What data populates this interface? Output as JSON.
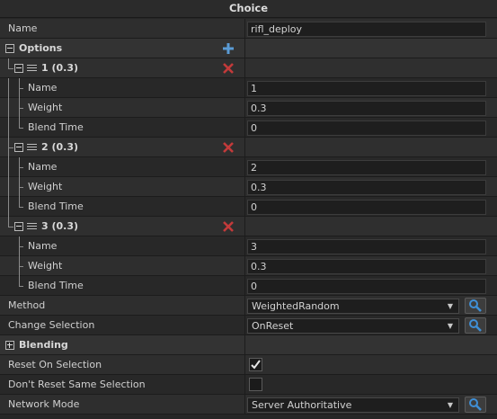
{
  "window_title": "Choice",
  "name": {
    "label": "Name",
    "value": "rifl_deploy"
  },
  "options": {
    "label": "Options",
    "items": [
      {
        "header": "1 (0.3)",
        "name_label": "Name",
        "name_value": "1",
        "weight_label": "Weight",
        "weight_value": "0.3",
        "blend_label": "Blend Time",
        "blend_value": "0"
      },
      {
        "header": "2 (0.3)",
        "name_label": "Name",
        "name_value": "2",
        "weight_label": "Weight",
        "weight_value": "0.3",
        "blend_label": "Blend Time",
        "blend_value": "0"
      },
      {
        "header": "3 (0.3)",
        "name_label": "Name",
        "name_value": "3",
        "weight_label": "Weight",
        "weight_value": "0.3",
        "blend_label": "Blend Time",
        "blend_value": "0"
      }
    ]
  },
  "method": {
    "label": "Method",
    "value": "WeightedRandom"
  },
  "change_selection": {
    "label": "Change Selection",
    "value": "OnReset"
  },
  "blending": {
    "label": "Blending"
  },
  "reset_on_selection": {
    "label": "Reset On Selection",
    "checked": true
  },
  "dont_reset_same": {
    "label": "Don't Reset Same Selection",
    "checked": false
  },
  "network_mode": {
    "label": "Network Mode",
    "value": "Server Authoritative"
  },
  "colors": {
    "delete": "#c23a3a",
    "add": "#5a9bd5",
    "search": "#3f8fd6"
  }
}
